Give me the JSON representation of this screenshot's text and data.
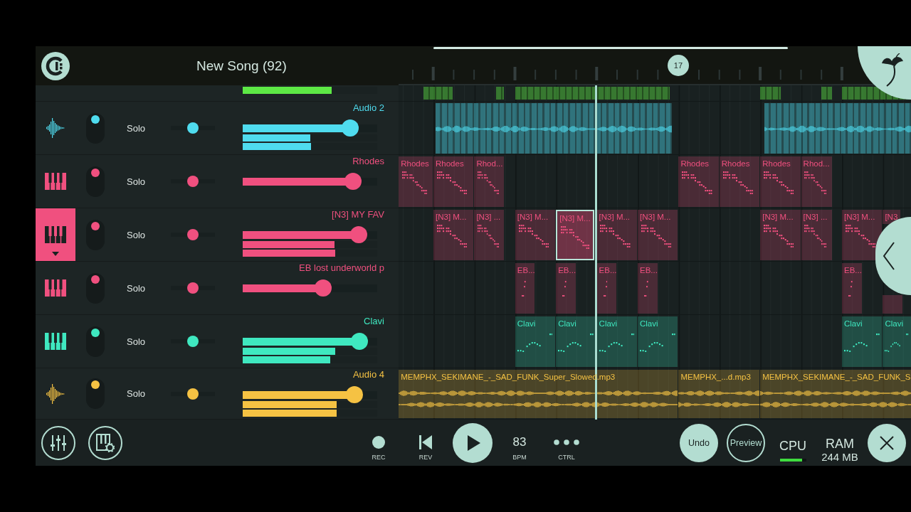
{
  "header": {
    "title": "New Song (92)",
    "marker": "17"
  },
  "partial_track": {
    "color": "#5de845",
    "meters": [
      {
        "level": 0.66
      }
    ],
    "clips": [
      {
        "kind": "block",
        "selected": false
      },
      {
        "kind": "block",
        "selected": false
      },
      {
        "kind": "block",
        "selected": false
      },
      {
        "kind": "block",
        "selected": false
      },
      {
        "kind": "block",
        "selected": false
      },
      {
        "kind": "block",
        "selected": false
      }
    ]
  },
  "tracks": [
    {
      "name": "Audio 2",
      "kind": "audio",
      "color": "#4fdcef",
      "selected": false,
      "enabled": true,
      "solo_button": "Solo",
      "pan": {
        "level": 0.5
      },
      "volume": {
        "level": 0.8
      },
      "meters": [
        {
          "level": 0.5
        },
        {
          "level": 0.51
        }
      ],
      "clips": [
        {
          "kind": "slices",
          "selected": false
        },
        {
          "kind": "slices",
          "selected": false
        }
      ]
    },
    {
      "name": "Rhodes",
      "kind": "instrument",
      "color": "#f0507f",
      "selected": false,
      "enabled": true,
      "solo_button": "Solo",
      "pan": {
        "level": 0.5
      },
      "volume": {
        "level": 0.82
      },
      "clips": [
        {
          "kind": "pattern",
          "label": "Rhodes",
          "selected": false
        },
        {
          "kind": "pattern",
          "label": "Rhodes",
          "selected": false
        },
        {
          "kind": "pattern",
          "label": "Rhod...",
          "selected": false
        },
        {
          "kind": "pattern",
          "label": "Rhodes",
          "selected": false
        },
        {
          "kind": "pattern",
          "label": "Rhodes",
          "selected": false
        },
        {
          "kind": "pattern",
          "label": "Rhodes",
          "selected": false
        },
        {
          "kind": "pattern",
          "label": "Rhod...",
          "selected": false
        }
      ]
    },
    {
      "name": "[N3] MY FAV",
      "kind": "instrument",
      "color": "#f0507f",
      "selected": true,
      "enabled": true,
      "solo_button": "Solo",
      "pan": {
        "level": 0.5
      },
      "volume": {
        "level": 0.86
      },
      "meters": [
        {
          "level": 0.68
        },
        {
          "level": 0.69
        }
      ],
      "clips": [
        {
          "kind": "pattern",
          "label": "[N3] M...",
          "selected": false
        },
        {
          "kind": "pattern",
          "label": "[N3] ...",
          "selected": false
        },
        {
          "kind": "pattern",
          "label": "[N3] M...",
          "selected": false
        },
        {
          "kind": "pattern",
          "label": "[N3] M...",
          "selected": true
        },
        {
          "kind": "pattern",
          "label": "[N3] M...",
          "selected": false
        },
        {
          "kind": "pattern",
          "label": "[N3] M...",
          "selected": false
        },
        {
          "kind": "pattern",
          "label": "[N3] M...",
          "selected": false
        },
        {
          "kind": "pattern",
          "label": "[N3] ...",
          "selected": false
        },
        {
          "kind": "pattern",
          "label": "[N3] M...",
          "selected": false
        },
        {
          "kind": "pattern",
          "label": "[N3",
          "selected": false
        }
      ]
    },
    {
      "name": "EB lost underworld p",
      "kind": "instrument",
      "color": "#f0507f",
      "selected": false,
      "enabled": true,
      "solo_button": "Solo",
      "pan": {
        "level": 0.5
      },
      "volume": {
        "level": 0.6
      },
      "clips": [
        {
          "kind": "pattern",
          "label": "EB...",
          "selected": false
        },
        {
          "kind": "pattern",
          "label": "EB...",
          "selected": false
        },
        {
          "kind": "pattern",
          "label": "EB...",
          "selected": false
        },
        {
          "kind": "pattern",
          "label": "EB...",
          "selected": false
        },
        {
          "kind": "pattern",
          "label": "EB...",
          "selected": false
        },
        {
          "kind": "pattern",
          "selected": false
        }
      ]
    },
    {
      "name": "Clavi",
      "kind": "instrument",
      "color": "#3fe8c0",
      "selected": false,
      "enabled": true,
      "solo_button": "Solo",
      "pan": {
        "level": 0.5
      },
      "volume": {
        "level": 0.87
      },
      "meters": [
        {
          "level": 0.69
        },
        {
          "level": 0.65
        }
      ],
      "clips": [
        {
          "kind": "pattern",
          "label": "Clavi",
          "selected": false
        },
        {
          "kind": "pattern",
          "label": "Clavi",
          "selected": false
        },
        {
          "kind": "pattern",
          "label": "Clavi",
          "selected": false
        },
        {
          "kind": "pattern",
          "label": "Clavi",
          "selected": false
        },
        {
          "kind": "pattern",
          "label": "Clavi",
          "selected": false
        },
        {
          "kind": "pattern",
          "label": "Clavi",
          "selected": false
        }
      ]
    },
    {
      "name": "Audio 4",
      "kind": "audio",
      "color": "#f5c243",
      "selected": false,
      "enabled": true,
      "solo_button": "Solo",
      "pan": {
        "level": 0.5
      },
      "volume": {
        "level": 0.83
      },
      "meters": [
        {
          "level": 0.7
        },
        {
          "level": 0.7
        }
      ],
      "clips": [
        {
          "kind": "audio",
          "label": "MEMPHX_SEKIMANE_-_SAD_FUNK_Super_Slowed.mp3",
          "selected": false
        },
        {
          "kind": "audio",
          "label": "MEMPHX_...d.mp3",
          "selected": false
        },
        {
          "kind": "audio",
          "label": "MEMPHX_SEKIMANE_-_SAD_FUNK_S",
          "selected": false
        }
      ]
    }
  ],
  "transport": [
    {
      "kind": "rec",
      "label": "REC"
    },
    {
      "kind": "rev",
      "label": "REV"
    },
    {
      "kind": "play"
    },
    {
      "kind": "bpm",
      "value": "83",
      "label": "BPM"
    },
    {
      "kind": "ctrl",
      "label": "CTRL"
    }
  ],
  "actions": [
    {
      "kind": "filled",
      "label": "Undo"
    },
    {
      "kind": "outline",
      "label": "Preview"
    }
  ],
  "cpu": {
    "label": "CPU",
    "level": 0.85
  },
  "ram": {
    "label": "RAM",
    "value": "244 MB"
  }
}
